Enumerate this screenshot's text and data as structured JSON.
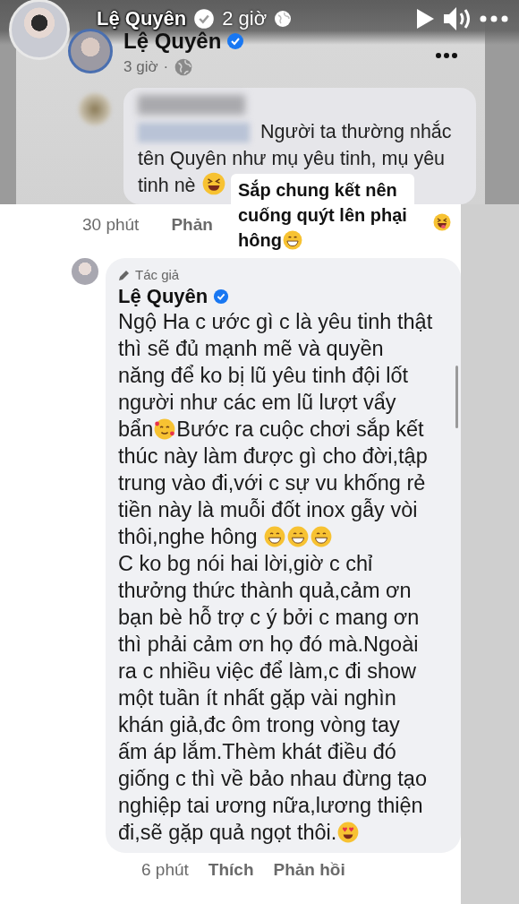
{
  "story_header": {
    "name": "Lệ Quyên",
    "verified": true,
    "time": "2 giờ"
  },
  "post": {
    "author": "Lệ Quyên",
    "verified": true,
    "time": "3 giờ",
    "separator": "·"
  },
  "reply": {
    "text": "Người ta thường nhắc tên Quyên như mụ yêu tinh, mụ yêu tinh nè",
    "time": "30 phút",
    "action": "Phản"
  },
  "sticker": {
    "lines": [
      "Sắp chung kết nên",
      "cuống quýt lên phại",
      "hông"
    ]
  },
  "comment": {
    "badge": "Tác giả",
    "author": "Lệ Quyên",
    "verified": true,
    "body": [
      {
        "kind": "text",
        "text": "Ngộ Ha c ước gì c là yêu tinh thật thì sẽ đủ mạnh mẽ và quyền năng để ko bị lũ yêu tinh đội lốt người như các em lũ lượt vẩy bẩn"
      },
      {
        "kind": "hearts"
      },
      {
        "kind": "text",
        "text": "Bước ra cuộc chơi sắp kết thúc này làm được gì cho đời,tập trung vào đi,với c sự vu khống rẻ tiền này là muỗi đốt inox gẫy vòi thôi,nghe hông "
      },
      {
        "kind": "grin"
      },
      {
        "kind": "grin"
      },
      {
        "kind": "grin"
      },
      {
        "kind": "break"
      },
      {
        "kind": "text",
        "text": "C ko bg nói hai lời,giờ c chỉ thưởng thức thành quả,cảm ơn bạn bè hỗ trợ c ý bởi c mang ơn thì phải cảm ơn họ đó mà.Ngoài ra c nhiều việc để làm,c đi show một tuần ít nhất gặp vài nghìn khán giả,đc ôm trong vòng tay ấm áp lắm.Thèm khát điều đó giống c thì về bảo nhau đừng tạo nghiệp tai ương nữa,lương thiện đi,sẽ gặp quả ngọt thôi."
      },
      {
        "kind": "heart-eyes"
      }
    ],
    "actions": [
      {
        "kind": "time",
        "label": "6 phút"
      },
      {
        "kind": "link",
        "label": "Thích"
      },
      {
        "kind": "link",
        "label": "Phản hồi"
      }
    ]
  }
}
